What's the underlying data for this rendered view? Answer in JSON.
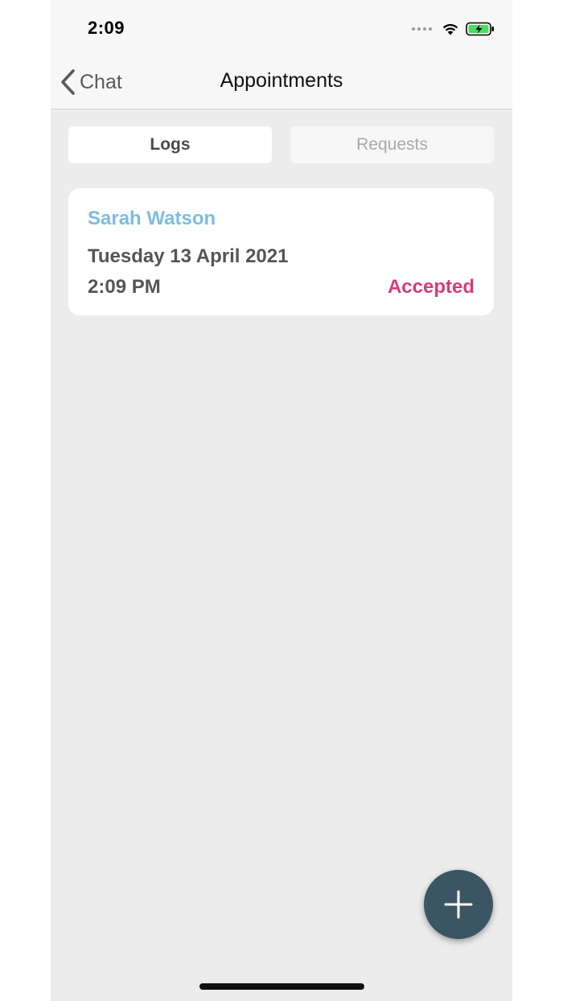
{
  "status_bar": {
    "time": "2:09",
    "icons": [
      "signal-dots-icon",
      "wifi-icon",
      "battery-charging-icon"
    ]
  },
  "nav": {
    "back_label": "Chat",
    "title": "Appointments"
  },
  "tabs": [
    {
      "label": "Logs",
      "selected": true
    },
    {
      "label": "Requests",
      "selected": false
    }
  ],
  "appointments": [
    {
      "name": "Sarah Watson",
      "date": "Tuesday 13 April 2021",
      "time": "2:09 PM",
      "status": "Accepted"
    }
  ],
  "colors": {
    "name": "#7cbde0",
    "status_accepted": "#d63a7c",
    "fab": "#3c5562",
    "background": "#ececec"
  },
  "fab": {
    "icon": "plus-icon"
  }
}
